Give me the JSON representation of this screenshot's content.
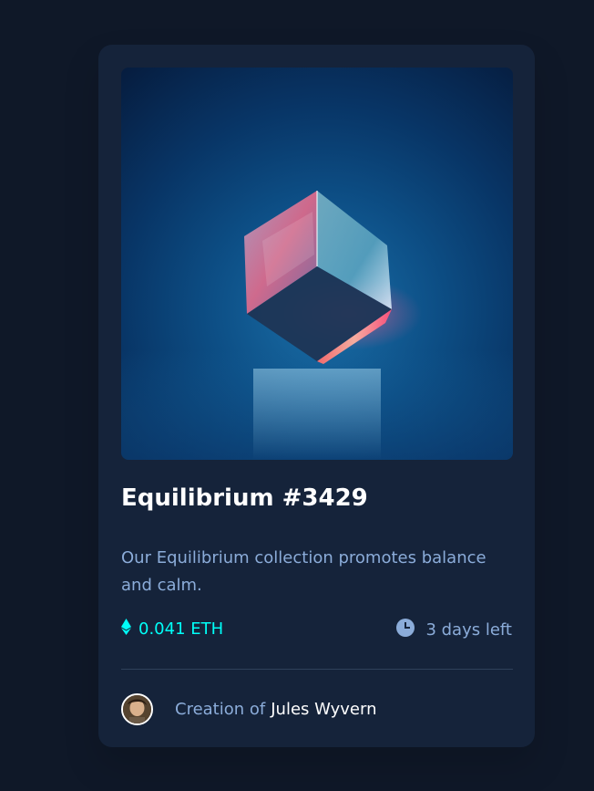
{
  "card": {
    "image": {
      "alt": "Equilibrium",
      "icon": "crystal-cube-image"
    },
    "title": "Equilibrium #3429",
    "description": "Our Equilibrium collection promotes balance and calm.",
    "price": {
      "icon": "ethereum-icon",
      "value": "0.041 ETH"
    },
    "time": {
      "icon": "clock-icon",
      "value": "3 days left"
    },
    "creator": {
      "avatar_icon": "avatar-icon",
      "prefix": "Creation of",
      "name": "Jules Wyvern"
    }
  },
  "colors": {
    "background": "#0f1828",
    "card": "#15233a",
    "cyan": "#00fff8",
    "soft_blue": "#8bacd9",
    "white": "#ffffff"
  }
}
